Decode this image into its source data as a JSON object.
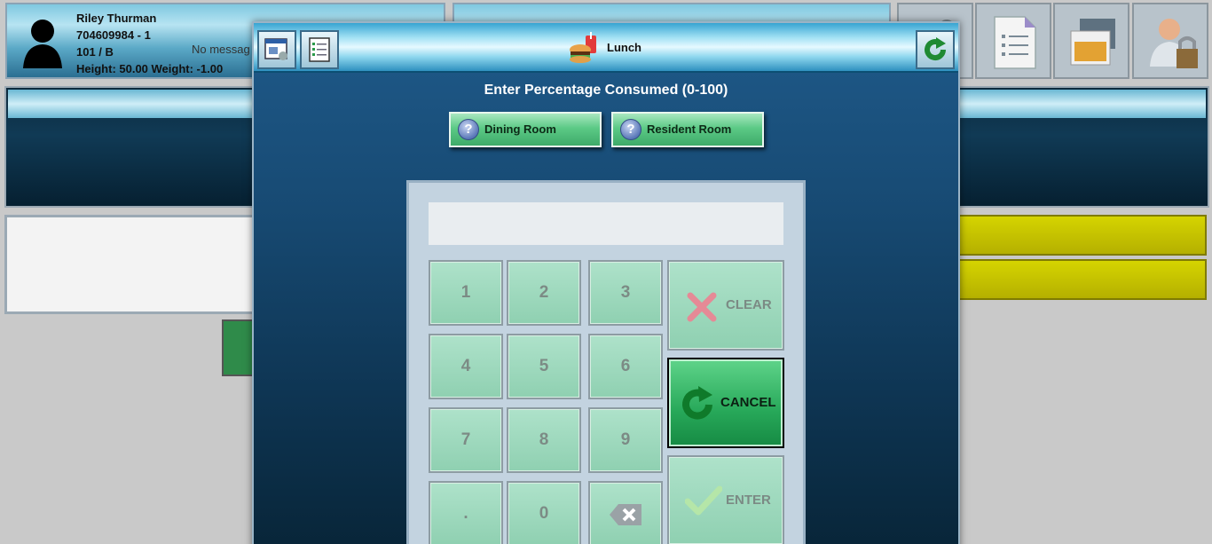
{
  "resident": {
    "name": "Riley Thurman",
    "id": "704609984 - 1",
    "room": "101 / B",
    "vitals": "Height: 50.00 Weight: -1.00"
  },
  "background": {
    "messages_text": "No messag"
  },
  "modal": {
    "title": "Lunch",
    "prompt": "Enter Percentage Consumed (0-100)",
    "location_buttons": [
      "Dining Room",
      "Resident Room"
    ],
    "display_value": "",
    "keys": [
      "1",
      "2",
      "3",
      "4",
      "5",
      "6",
      "7",
      "8",
      "9",
      ".",
      "0"
    ],
    "clear_label": "CLEAR",
    "cancel_label": "CANCEL",
    "enter_label": "ENTER"
  },
  "icons": {
    "avatar": "person-silhouette-icon",
    "meal": "meal-icon",
    "refresh": "refresh-icon",
    "clear": "red-x-icon",
    "enter": "check-icon",
    "backspace": "backspace-icon"
  },
  "colors": {
    "accent_green": "#27a859",
    "modal_blue": "#174a73",
    "alert_yellow": "#d5d400"
  }
}
